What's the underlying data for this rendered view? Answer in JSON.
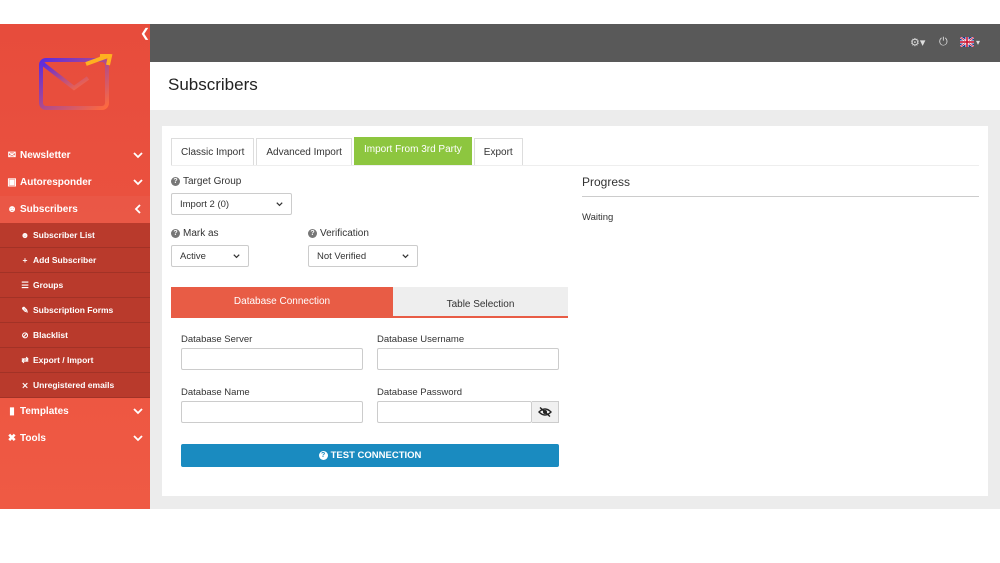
{
  "sidebar": {
    "items": [
      {
        "label": "Newsletter",
        "icon": "envelope-icon"
      },
      {
        "label": "Autoresponder",
        "icon": "car-icon"
      },
      {
        "label": "Subscribers",
        "icon": "users-icon"
      },
      {
        "label": "Templates",
        "icon": "paint-roller-icon"
      },
      {
        "label": "Tools",
        "icon": "tools-icon"
      }
    ],
    "subitems": [
      {
        "label": "Subscriber List",
        "icon": "users-icon"
      },
      {
        "label": "Add Subscriber",
        "icon": "plus-icon"
      },
      {
        "label": "Groups",
        "icon": "list-icon"
      },
      {
        "label": "Subscription Forms",
        "icon": "edit-icon"
      },
      {
        "label": "Blacklist",
        "icon": "ban-icon"
      },
      {
        "label": "Export / Import",
        "icon": "exchange-icon"
      },
      {
        "label": "Unregistered emails",
        "icon": "user-slash-icon"
      }
    ]
  },
  "header": {
    "title": "Subscribers"
  },
  "tabs": [
    {
      "label": "Classic Import"
    },
    {
      "label": "Advanced Import"
    },
    {
      "label": "Import From 3rd Party"
    },
    {
      "label": "Export"
    }
  ],
  "form": {
    "target_group_label": "Target Group",
    "target_group_value": "Import 2 (0)",
    "mark_as_label": "Mark as",
    "mark_as_value": "Active",
    "verification_label": "Verification",
    "verification_value": "Not Verified"
  },
  "progress": {
    "title": "Progress",
    "status": "Waiting"
  },
  "wizard": {
    "tab1": "Database Connection",
    "tab2": "Table Selection",
    "server_label": "Database Server",
    "username_label": "Database Username",
    "name_label": "Database Name",
    "password_label": "Database Password",
    "test_button": "TEST CONNECTION"
  },
  "colors": {
    "sidebar": "#e74c3c",
    "topbar": "#595959",
    "active_tab": "#8dc63f",
    "wizard_accent": "#e85c45",
    "primary_button": "#1a8bc0"
  }
}
